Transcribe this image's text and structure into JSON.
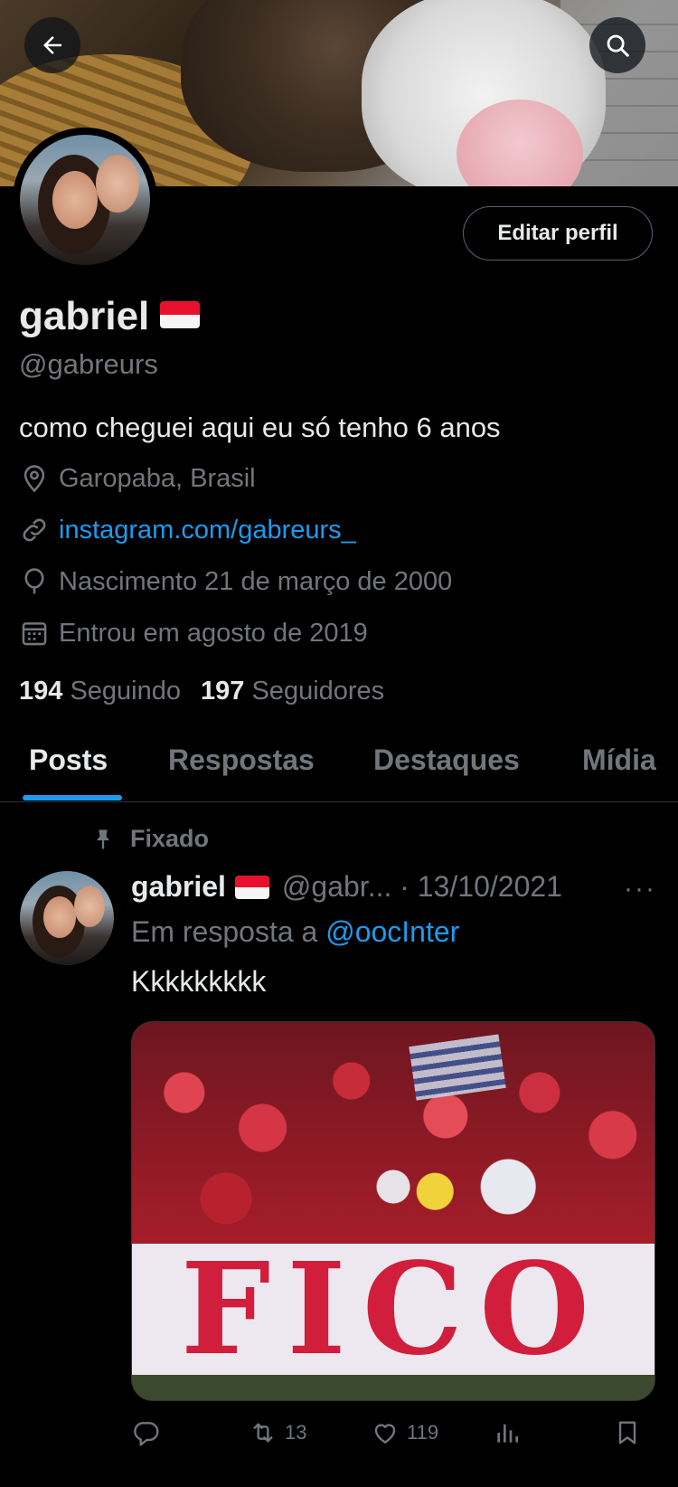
{
  "header": {
    "back_label": "back",
    "search_label": "search"
  },
  "profile": {
    "name": "gabriel",
    "handle": "@gabreurs",
    "bio": "como cheguei aqui eu só tenho 6 anos",
    "location": "Garopaba, Brasil",
    "link": "instagram.com/gabreurs_",
    "birth": "Nascimento 21 de março de 2000",
    "joined": "Entrou em agosto de 2019",
    "following_count": "194",
    "following_label": "Seguindo",
    "followers_count": "197",
    "followers_label": "Seguidores",
    "edit_button": "Editar perfil",
    "flag_colors": [
      "#e8112d",
      "#f5f5f5"
    ]
  },
  "tabs": [
    {
      "label": "Posts",
      "active": true
    },
    {
      "label": "Respostas",
      "active": false
    },
    {
      "label": "Destaques",
      "active": false
    },
    {
      "label": "Mídia",
      "active": false
    }
  ],
  "post": {
    "pinned_label": "Fixado",
    "name": "gabriel",
    "handle_date": "@gabr... · 13/10/2021",
    "more": "···",
    "reply_prefix": "Em resposta a",
    "reply_mention": "@oocInter",
    "text": "Kkkkkkkkk",
    "media_text": "FICO",
    "retweets": "13",
    "likes": "119"
  },
  "colors": {
    "accent": "#1d9bf0",
    "muted": "#71767b",
    "text": "#e7e9ea",
    "background": "#000000"
  }
}
